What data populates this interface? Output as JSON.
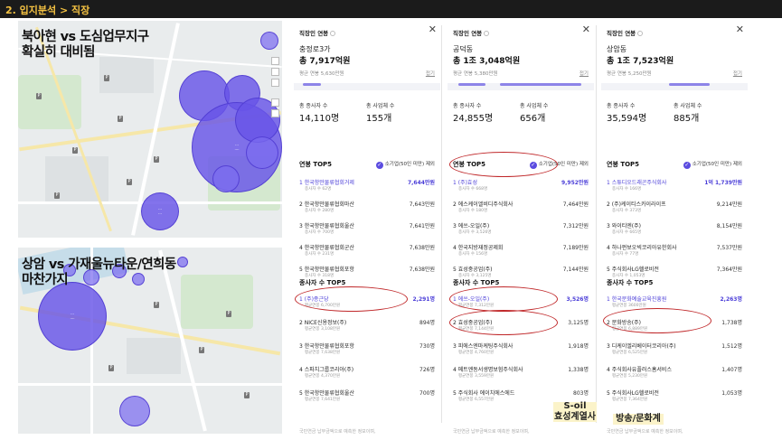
{
  "header": {
    "breadcrumb": "2. 입지분석 > 직장"
  },
  "overlays": {
    "map1_title": [
      "북아현 vs 도심업무지구",
      "확실히 대비됨"
    ],
    "map2_title": [
      "상암 vs 가재울뉴타운/연희동",
      "마찬가지"
    ],
    "note_soil": [
      "S-oil",
      "효성계열사"
    ],
    "note_broadcast": "방송/문화계"
  },
  "colors": {
    "accent": "#5b4ce0",
    "bubble": "#6854e8",
    "highlight": "#c0282a",
    "header_text": "#f5c242"
  },
  "panels": [
    {
      "title": "직장인 연봉",
      "area": "충정로3가",
      "total": "총 7,917억원",
      "avg": "평균 연봉 5,630만원",
      "fold": "접기",
      "employees_label": "총 종사자 수",
      "employees": "14,110명",
      "businesses_label": "총 사업체 수",
      "businesses": "155개",
      "salary_title": "연봉 TOP5",
      "exclude_label": "소기업(50인 미만) 제외",
      "salary_top5": [
        {
          "name": "1 한국항만물류협회거제",
          "sub": "종사자 수 62명",
          "value": "7,644만원"
        },
        {
          "name": "2 한국항만물류협회마산",
          "sub": "종사자 수 280명",
          "value": "7,643만원"
        },
        {
          "name": "3 한국항만물류협회울산",
          "sub": "종사자 수 700명",
          "value": "7,641만원"
        },
        {
          "name": "4 한국항만물류협회군산",
          "sub": "종사자 수 231명",
          "value": "7,638만원"
        },
        {
          "name": "5 한국항만물류협회포항",
          "sub": "종사자 수 318명",
          "value": "7,638만원"
        }
      ],
      "employees_title": "종사자 수 TOP5",
      "employees_top5": [
        {
          "name": "1 (주)종근당",
          "sub": "평균연봉 6,700만원",
          "value": "2,291명"
        },
        {
          "name": "2 NICE신용정보(주)",
          "sub": "평균연봉 3,108만원",
          "value": "894명"
        },
        {
          "name": "3 한국항만물류협회포항",
          "sub": "평균연봉 7,638만원",
          "value": "730명"
        },
        {
          "name": "4 스파치그룹코리아(주)",
          "sub": "평균연봉 4,370만원",
          "value": "726명"
        },
        {
          "name": "5 한국항만물류협회울산",
          "sub": "평균연봉 7,641만원",
          "value": "700명"
        }
      ],
      "footnote": "국민연금 납부금액으로 예측한 정보이며,"
    },
    {
      "title": "직장인 연봉",
      "area": "공덕동",
      "total": "총 1조 3,048억원",
      "avg": "평균 연봉 5,380만원",
      "fold": "접기",
      "employees_label": "총 종사자 수",
      "employees": "24,855명",
      "businesses_label": "총 사업체 수",
      "businesses": "656개",
      "salary_title": "연봉 TOP5",
      "exclude_label": "소기업(50인 미만) 제외",
      "salary_top5": [
        {
          "name": "1 (주)효성",
          "sub": "종사자 수 668명",
          "value": "9,952만원"
        },
        {
          "name": "2 에스케이엘비디주식회사",
          "sub": "종사자 수 180명",
          "value": "7,464만원"
        },
        {
          "name": "3 에쓰-오일(주)",
          "sub": "종사자 수 3,526명",
          "value": "7,312만원"
        },
        {
          "name": "4 한국지방재정공제회",
          "sub": "종사자 수 156명",
          "value": "7,189만원"
        },
        {
          "name": "5 효성중공업(주)",
          "sub": "종사자 수 3,125명",
          "value": "7,144만원"
        }
      ],
      "employees_title": "종사자 수 TOP5",
      "employees_top5": [
        {
          "name": "1 에쓰-오일(주)",
          "sub": "평균연봉 7,312만원",
          "value": "3,526명"
        },
        {
          "name": "2 효성중공업(주)",
          "sub": "평균연봉 7,144만원",
          "value": "3,125명"
        },
        {
          "name": "3 피에스엔마케팅주식회사",
          "sub": "평균연봉 4,760만원",
          "value": "1,918명"
        },
        {
          "name": "4 메트엔동서생명보험주식회사",
          "sub": "평균연봉 3,559만원",
          "value": "1,338명"
        },
        {
          "name": "5 주식회사 에이치에스에드",
          "sub": "평균연봉 6,557만원",
          "value": "803명"
        }
      ],
      "footnote": "국민연금 납부금액으로 예측한 정보이며,"
    },
    {
      "title": "직장인 연봉",
      "area": "상암동",
      "total": "총 1조 7,523억원",
      "avg": "평균 연봉 5,250만원",
      "fold": "접기",
      "employees_label": "총 종사자 수",
      "employees": "35,594명",
      "businesses_label": "총 사업체 수",
      "businesses": "885개",
      "salary_title": "연봉 TOP5",
      "exclude_label": "소기업(50인 미만) 제외",
      "salary_top5": [
        {
          "name": "1 스튜디오드래곤주식회사",
          "sub": "종사자 수 166명",
          "value": "1억 1,739만원"
        },
        {
          "name": "2 (주)케이티스카이라이프",
          "sub": "종사자 수 373명",
          "value": "9,214만원"
        },
        {
          "name": "3 와이티엔(주)",
          "sub": "종사자 수 665명",
          "value": "8,154만원"
        },
        {
          "name": "4 하나펀보오빅코리아유한회사",
          "sub": "종사자 수 77명",
          "value": "7,537만원"
        },
        {
          "name": "5 주식회사LG헬로비전",
          "sub": "종사자 수 1,053명",
          "value": "7,364만원"
        }
      ],
      "employees_title": "종사자 수 TOP5",
      "employees_top5": [
        {
          "name": "1 한국문화예술교육진흥원",
          "sub": "평균연봉 3600만원",
          "value": "2,263명"
        },
        {
          "name": "2 문화방송(주)",
          "sub": "평균연봉 6,889만원",
          "value": "1,738명"
        },
        {
          "name": "3 디케이엘리베이터코리아(주)",
          "sub": "평균연봉 6,525만원",
          "value": "1,512명"
        },
        {
          "name": "4 주식회사유플러스홈서비스",
          "sub": "평균연봉 5,230만원",
          "value": "1,407명"
        },
        {
          "name": "5 주식회사LG헬로비전",
          "sub": "평균연봉 7,364만원",
          "value": "1,053명"
        }
      ],
      "footnote": "국민연금 납부금액으로 예측한 정보이며,"
    }
  ]
}
